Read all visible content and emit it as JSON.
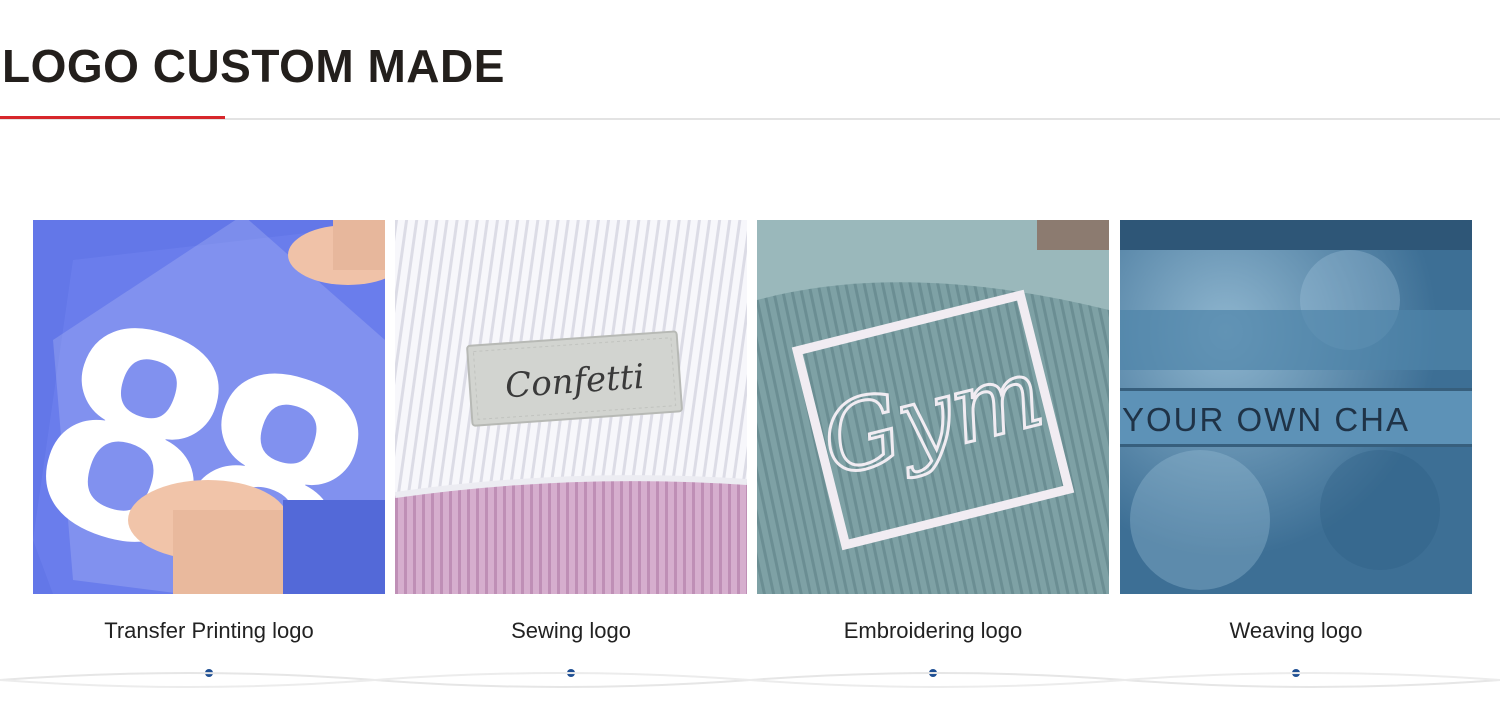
{
  "section": {
    "title": "LOGO CUSTOM MADE"
  },
  "colors": {
    "accent_red": "#d7262b",
    "dot_blue": "#1f4f93",
    "title_text": "#231f1c"
  },
  "cards": [
    {
      "caption": "Transfer Printing logo",
      "image": {
        "icon": "heat-transfer-number-88-photo",
        "printed_text": "88"
      }
    },
    {
      "caption": "Sewing logo",
      "image": {
        "icon": "sewn-label-photo",
        "printed_text": "Confetti"
      }
    },
    {
      "caption": "Embroidering logo",
      "image": {
        "icon": "embroidered-monogram-photo",
        "printed_text": "Gym"
      }
    },
    {
      "caption": "Weaving logo",
      "image": {
        "icon": "woven-tape-photo",
        "printed_text": "YOUR OWN CHA"
      }
    }
  ]
}
